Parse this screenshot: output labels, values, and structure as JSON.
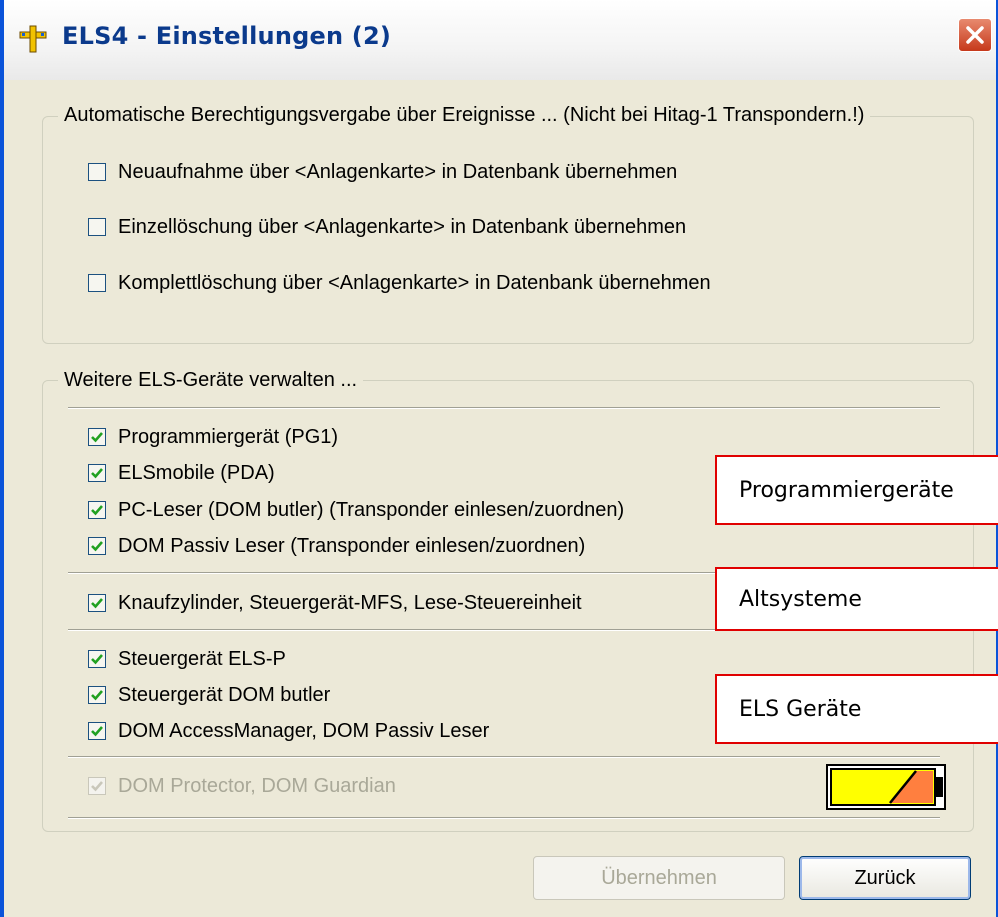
{
  "window": {
    "title": "ELS4 - Einstellungen (2)"
  },
  "group_auto": {
    "legend": "Automatische Berechtigungsvergabe über Ereignisse ... (Nicht bei Hitag-1 Transpondern.!)",
    "items": [
      {
        "label": "Neuaufnahme über <Anlagenkarte> in Datenbank übernehmen",
        "checked": false
      },
      {
        "label": "Einzellöschung über <Anlagenkarte> in Datenbank übernehmen",
        "checked": false
      },
      {
        "label": "Komplettlöschung über <Anlagenkarte> in Datenbank übernehmen",
        "checked": false
      }
    ]
  },
  "group_devices": {
    "legend": "Weitere ELS-Geräte verwalten ...",
    "programmer_items": [
      {
        "label": "Programmiergerät (PG1)",
        "checked": true
      },
      {
        "label": "ELSmobile (PDA)",
        "checked": true
      },
      {
        "label": "PC-Leser (DOM butler) (Transponder einlesen/zuordnen)",
        "checked": true
      },
      {
        "label": "DOM Passiv Leser (Transponder einlesen/zuordnen)",
        "checked": true
      }
    ],
    "legacy_items": [
      {
        "label": "Knaufzylinder, Steuergerät-MFS, Lese-Steuereinheit",
        "checked": true
      }
    ],
    "els_items": [
      {
        "label": "Steuergerät ELS-P",
        "checked": true
      },
      {
        "label": "Steuergerät DOM butler",
        "checked": true
      },
      {
        "label": "DOM AccessManager, DOM Passiv Leser",
        "checked": true
      }
    ],
    "disabled_item": {
      "label": "DOM Protector, DOM Guardian",
      "checked": true
    }
  },
  "callouts": {
    "programmer": "Programmiergeräte",
    "legacy": "Altsysteme",
    "els": "ELS Geräte"
  },
  "battery": {
    "fill_fraction": 0.55,
    "color_low": "#ff7f3f",
    "color_high": "#ffff00"
  },
  "buttons": {
    "apply": "Übernehmen",
    "back": "Zurück"
  },
  "colors": {
    "title_text": "#0b3a8c",
    "window_frame": "#0a53d9",
    "callout_border": "#e00000",
    "check_mark": "#21a121"
  }
}
